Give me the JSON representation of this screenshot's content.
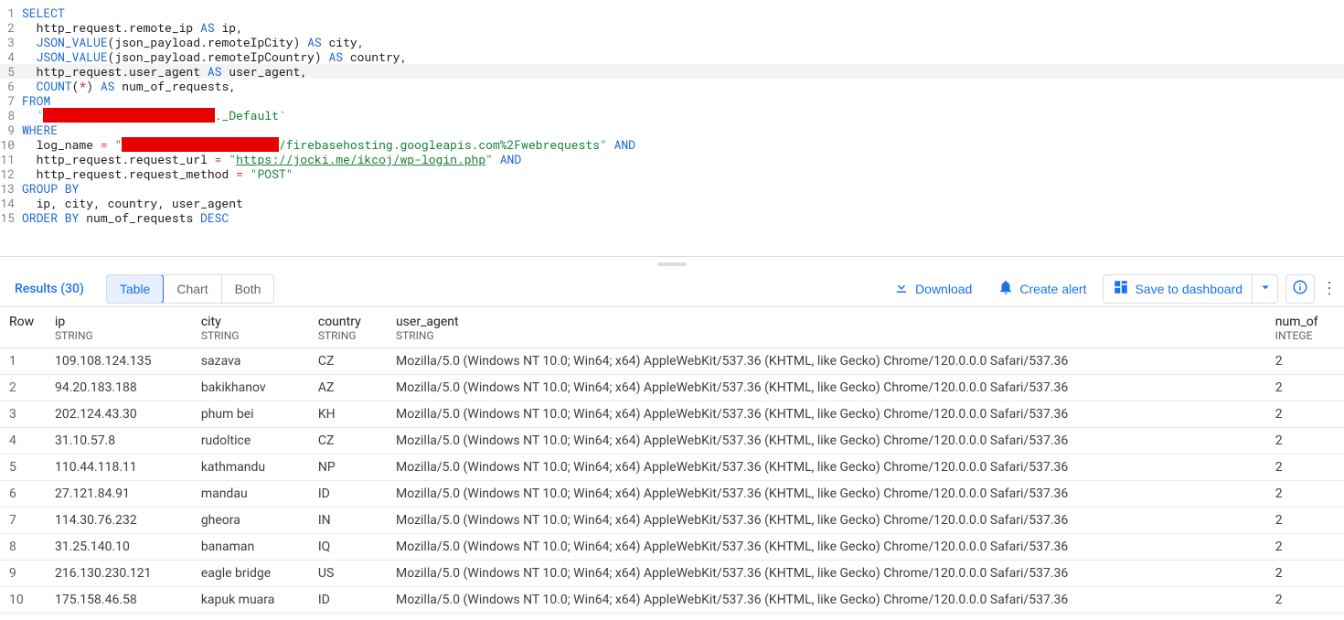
{
  "sql": {
    "lines": [
      {
        "n": 1,
        "t": [
          {
            "c": "kw",
            "v": "SELECT"
          }
        ]
      },
      {
        "n": 2,
        "t": [
          {
            "c": "norm",
            "v": "  http_request.remote_ip "
          },
          {
            "c": "kw",
            "v": "AS"
          },
          {
            "c": "norm",
            "v": " ip,"
          }
        ]
      },
      {
        "n": 3,
        "t": [
          {
            "c": "norm",
            "v": "  "
          },
          {
            "c": "fn",
            "v": "JSON_VALUE"
          },
          {
            "c": "norm",
            "v": "(json_payload.remoteIpCity) "
          },
          {
            "c": "kw",
            "v": "AS"
          },
          {
            "c": "norm",
            "v": " city,"
          }
        ]
      },
      {
        "n": 4,
        "t": [
          {
            "c": "norm",
            "v": "  "
          },
          {
            "c": "fn",
            "v": "JSON_VALUE"
          },
          {
            "c": "norm",
            "v": "(json_payload.remoteIpCountry) "
          },
          {
            "c": "kw",
            "v": "AS"
          },
          {
            "c": "norm",
            "v": " country,"
          }
        ]
      },
      {
        "n": 5,
        "hl": true,
        "t": [
          {
            "c": "norm",
            "v": "  http_request.user_agent "
          },
          {
            "c": "kw",
            "v": "AS"
          },
          {
            "c": "norm",
            "v": " user_agent,"
          }
        ]
      },
      {
        "n": 6,
        "t": [
          {
            "c": "norm",
            "v": "  "
          },
          {
            "c": "fn",
            "v": "COUNT"
          },
          {
            "c": "norm",
            "v": "("
          },
          {
            "c": "op",
            "v": "*"
          },
          {
            "c": "norm",
            "v": ") "
          },
          {
            "c": "kw",
            "v": "AS"
          },
          {
            "c": "norm",
            "v": " num_of_requests,"
          }
        ]
      },
      {
        "n": 7,
        "t": [
          {
            "c": "kw",
            "v": "FROM"
          }
        ]
      },
      {
        "n": 8,
        "t": [
          {
            "c": "norm",
            "v": "  "
          },
          {
            "c": "str",
            "v": "`"
          },
          {
            "c": "red",
            "v": "________________________"
          },
          {
            "c": "str",
            "v": "._Default`"
          }
        ]
      },
      {
        "n": 9,
        "t": [
          {
            "c": "kw",
            "v": "WHERE"
          }
        ]
      },
      {
        "n": 10,
        "t": [
          {
            "c": "norm",
            "v": "  log_name "
          },
          {
            "c": "op",
            "v": "="
          },
          {
            "c": "norm",
            "v": " "
          },
          {
            "c": "str",
            "v": "\""
          },
          {
            "c": "red",
            "v": "______________________"
          },
          {
            "c": "str",
            "v": "/firebasehosting.googleapis.com%2Fwebrequests\""
          },
          {
            "c": "norm",
            "v": " "
          },
          {
            "c": "kw",
            "v": "AND"
          }
        ]
      },
      {
        "n": 11,
        "t": [
          {
            "c": "norm",
            "v": "  http_request.request_url "
          },
          {
            "c": "op",
            "v": "="
          },
          {
            "c": "norm",
            "v": " "
          },
          {
            "c": "str",
            "v": "\""
          },
          {
            "c": "url",
            "v": "https://jocki.me/ikcoj/wp-login.php"
          },
          {
            "c": "str",
            "v": "\""
          },
          {
            "c": "norm",
            "v": " "
          },
          {
            "c": "kw",
            "v": "AND"
          }
        ]
      },
      {
        "n": 12,
        "t": [
          {
            "c": "norm",
            "v": "  http_request.request_method "
          },
          {
            "c": "op",
            "v": "="
          },
          {
            "c": "norm",
            "v": " "
          },
          {
            "c": "str",
            "v": "\"POST\""
          }
        ]
      },
      {
        "n": 13,
        "t": [
          {
            "c": "kw",
            "v": "GROUP BY"
          }
        ]
      },
      {
        "n": 14,
        "t": [
          {
            "c": "norm",
            "v": "  ip, city, country, user_agent"
          }
        ]
      },
      {
        "n": 15,
        "t": [
          {
            "c": "kw",
            "v": "ORDER BY"
          },
          {
            "c": "norm",
            "v": " num_of_requests "
          },
          {
            "c": "kw",
            "v": "DESC"
          }
        ]
      }
    ]
  },
  "toolbar": {
    "results_label": "Results (30)",
    "tabs": [
      "Table",
      "Chart",
      "Both"
    ],
    "active_tab": 0,
    "download": "Download",
    "create_alert": "Create alert",
    "save": "Save to dashboard"
  },
  "table": {
    "columns": [
      {
        "name": "Row",
        "type": ""
      },
      {
        "name": "ip",
        "type": "STRING"
      },
      {
        "name": "city",
        "type": "STRING"
      },
      {
        "name": "country",
        "type": "STRING"
      },
      {
        "name": "user_agent",
        "type": "STRING"
      },
      {
        "name": "num_of",
        "type": "INTEGE"
      }
    ],
    "rows": [
      {
        "row": 1,
        "ip": "109.108.124.135",
        "city": "sazava",
        "country": "CZ",
        "ua": "Mozilla/5.0 (Windows NT 10.0; Win64; x64) AppleWebKit/537.36 (KHTML, like Gecko) Chrome/120.0.0.0 Safari/537.36",
        "n": 2
      },
      {
        "row": 2,
        "ip": "94.20.183.188",
        "city": "bakikhanov",
        "country": "AZ",
        "ua": "Mozilla/5.0 (Windows NT 10.0; Win64; x64) AppleWebKit/537.36 (KHTML, like Gecko) Chrome/120.0.0.0 Safari/537.36",
        "n": 2
      },
      {
        "row": 3,
        "ip": "202.124.43.30",
        "city": "phum bei",
        "country": "KH",
        "ua": "Mozilla/5.0 (Windows NT 10.0; Win64; x64) AppleWebKit/537.36 (KHTML, like Gecko) Chrome/120.0.0.0 Safari/537.36",
        "n": 2
      },
      {
        "row": 4,
        "ip": "31.10.57.8",
        "city": "rudoltice",
        "country": "CZ",
        "ua": "Mozilla/5.0 (Windows NT 10.0; Win64; x64) AppleWebKit/537.36 (KHTML, like Gecko) Chrome/120.0.0.0 Safari/537.36",
        "n": 2
      },
      {
        "row": 5,
        "ip": "110.44.118.11",
        "city": "kathmandu",
        "country": "NP",
        "ua": "Mozilla/5.0 (Windows NT 10.0; Win64; x64) AppleWebKit/537.36 (KHTML, like Gecko) Chrome/120.0.0.0 Safari/537.36",
        "n": 2
      },
      {
        "row": 6,
        "ip": "27.121.84.91",
        "city": "mandau",
        "country": "ID",
        "ua": "Mozilla/5.0 (Windows NT 10.0; Win64; x64) AppleWebKit/537.36 (KHTML, like Gecko) Chrome/120.0.0.0 Safari/537.36",
        "n": 2
      },
      {
        "row": 7,
        "ip": "114.30.76.232",
        "city": "gheora",
        "country": "IN",
        "ua": "Mozilla/5.0 (Windows NT 10.0; Win64; x64) AppleWebKit/537.36 (KHTML, like Gecko) Chrome/120.0.0.0 Safari/537.36",
        "n": 2
      },
      {
        "row": 8,
        "ip": "31.25.140.10",
        "city": "banaman",
        "country": "IQ",
        "ua": "Mozilla/5.0 (Windows NT 10.0; Win64; x64) AppleWebKit/537.36 (KHTML, like Gecko) Chrome/120.0.0.0 Safari/537.36",
        "n": 2
      },
      {
        "row": 9,
        "ip": "216.130.230.121",
        "city": "eagle bridge",
        "country": "US",
        "ua": "Mozilla/5.0 (Windows NT 10.0; Win64; x64) AppleWebKit/537.36 (KHTML, like Gecko) Chrome/120.0.0.0 Safari/537.36",
        "n": 2
      },
      {
        "row": 10,
        "ip": "175.158.46.58",
        "city": "kapuk muara",
        "country": "ID",
        "ua": "Mozilla/5.0 (Windows NT 10.0; Win64; x64) AppleWebKit/537.36 (KHTML, like Gecko) Chrome/120.0.0.0 Safari/537.36",
        "n": 2
      }
    ]
  }
}
